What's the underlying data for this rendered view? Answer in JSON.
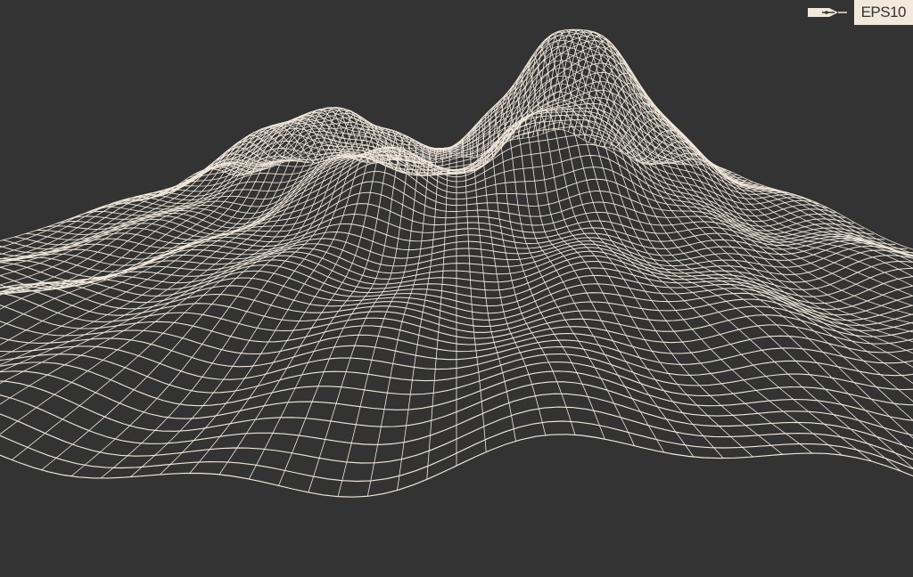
{
  "image": {
    "subject": "wireframe-terrain",
    "background_color": "#333333",
    "line_color": "#f2e8dc"
  },
  "badge": {
    "icon": "pen-nib-icon",
    "label": "EPS10"
  }
}
